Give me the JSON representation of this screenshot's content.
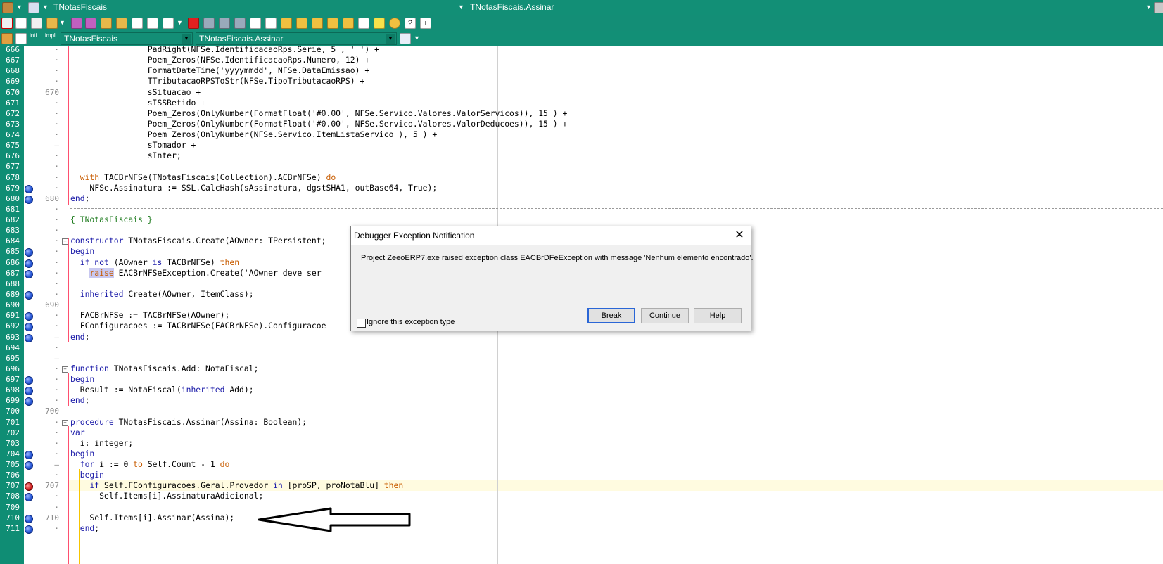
{
  "window": {
    "left_title": "TNotasFiscais",
    "right_title": "TNotasFiscais.Assinar"
  },
  "toolbar_bar3": {
    "intf_label": "intf",
    "impl_label": "impl",
    "class_combo": "TNotasFiscais",
    "method_combo": "TNotasFiscais.Assinar"
  },
  "editor": {
    "line_numbers": [
      "666",
      "667",
      "668",
      "669",
      "670",
      "671",
      "672",
      "673",
      "674",
      "675",
      "676",
      "677",
      "678",
      "679",
      "680",
      "681",
      "682",
      "683",
      "684",
      "685",
      "686",
      "687",
      "688",
      "689",
      "690",
      "691",
      "692",
      "693",
      "694",
      "695",
      "696",
      "697",
      "698",
      "699",
      "700",
      "701",
      "702",
      "703",
      "704",
      "705",
      "706",
      "707",
      "708",
      "709",
      "710",
      "711"
    ],
    "ruler_marks": [
      "670",
      "680",
      "690",
      "700",
      "707",
      "710"
    ],
    "lines": [
      "                PadRight(NFSe.IdentificacaoRps.Serie, 5 , ' ') +",
      "                Poem_Zeros(NFSe.IdentificacaoRps.Numero, 12) +",
      "                FormatDateTime('yyyymmdd', NFSe.DataEmissao) +",
      "                TTributacaoRPSToStr(NFSe.TipoTributacaoRPS) +",
      "                sSituacao +",
      "                sISSRetido +",
      "                Poem_Zeros(OnlyNumber(FormatFloat('#0.00', NFSe.Servico.Valores.ValorServicos)), 15 ) +",
      "                Poem_Zeros(OnlyNumber(FormatFloat('#0.00', NFSe.Servico.Valores.ValorDeducoes)), 15 ) +",
      "                Poem_Zeros(OnlyNumber(NFSe.Servico.ItemListaServico ), 5 ) +",
      "                sTomador +",
      "                sInter;",
      "",
      "  with TACBrNFSe(TNotasFiscais(Collection).ACBrNFSe) do",
      "    NFSe.Assinatura := SSL.CalcHash(sAssinatura, dgstSHA1, outBase64, True);",
      "end;",
      "",
      "{ TNotasFiscais }",
      "",
      "constructor TNotasFiscais.Create(AOwner: TPersistent;",
      "begin",
      "  if not (AOwner is TACBrNFSe) then",
      "    raise EACBrNFSeException.Create('AOwner deve ser",
      "",
      "  inherited Create(AOwner, ItemClass);",
      "",
      "  FACBrNFSe := TACBrNFSe(AOwner);",
      "  FConfiguracoes := TACBrNFSe(FACBrNFSe).Configuracoe",
      "end;",
      "",
      "",
      "function TNotasFiscais.Add: NotaFiscal;",
      "begin",
      "  Result := NotaFiscal(inherited Add);",
      "end;",
      "",
      "procedure TNotasFiscais.Assinar(Assina: Boolean);",
      "var",
      "  i: integer;",
      "begin",
      "  for i := 0 to Self.Count - 1 do",
      "  begin",
      "    if Self.FConfiguracoes.Geral.Provedor in [proSP, proNotaBlu] then",
      "      Self.Items[i].AssinaturaAdicional;",
      "",
      "    Self.Items[i].Assinar(Assina);",
      "  end;"
    ]
  },
  "dialog": {
    "title": "Debugger Exception Notification",
    "close_label": "✕",
    "message": "Project ZeeoERP7.exe raised exception class EACBrDFeException with message 'Nenhum elemento encontrado'.",
    "checkbox_label": "Ignore this exception type",
    "break_label": "Break",
    "continue_label": "Continue",
    "help_label": "Help"
  },
  "colors": {
    "ide_teal": "#128f76",
    "keyword": "#c85c00",
    "comment": "#1c7a1c",
    "breakpoint": "#2858d8"
  }
}
